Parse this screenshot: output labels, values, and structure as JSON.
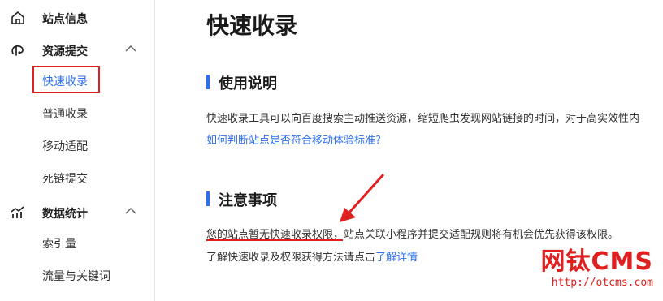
{
  "sidebar": {
    "groups": [
      {
        "label": "站点信息",
        "icon": "home-icon"
      },
      {
        "label": "资源提交",
        "icon": "submit-icon",
        "expanded": true,
        "items": [
          "快速收录",
          "普通收录",
          "移动适配",
          "死链提交"
        ]
      },
      {
        "label": "数据统计",
        "icon": "stats-icon",
        "expanded": true,
        "items": [
          "索引量",
          "流量与关键词"
        ]
      }
    ],
    "active_item": "快速收录"
  },
  "main": {
    "title": "快速收录",
    "usage": {
      "heading": "使用说明",
      "text": "快速收录工具可以向百度搜索主动推送资源，缩短爬虫发现网站链接的时间，对于高实效性内",
      "link": "如何判断站点是否符合移动体验标准?"
    },
    "notice": {
      "heading": "注意事项",
      "highlight": "您的站点暂无快速收录权限",
      "rest": "，站点关联小程序并提交适配规则将有机会优先获得该权限。",
      "line2_prefix": "了解快速收录及权限获得方法请点击",
      "line2_link": "了解详情"
    }
  },
  "watermark": {
    "text": "网钛CMS",
    "url": "http://otcms.com"
  },
  "colors": {
    "accent": "#2f6fea",
    "annotation": "#e02020"
  }
}
